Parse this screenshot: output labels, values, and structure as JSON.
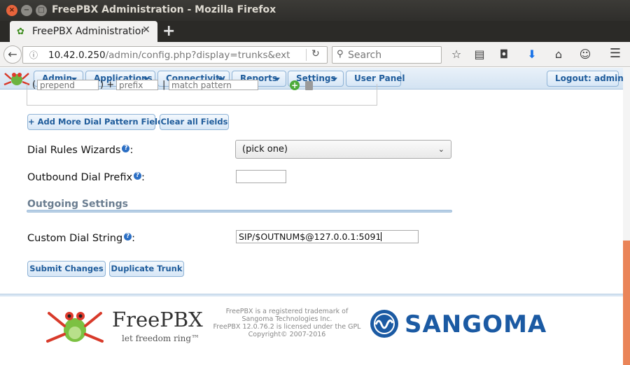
{
  "window": {
    "title": "FreePBX Administration - Mozilla Firefox"
  },
  "browser": {
    "tab_title": "FreePBX Administration",
    "url_host": "10.42.0.250",
    "url_path": "/admin/config.php?display=trunks&ext",
    "search_placeholder": "Search"
  },
  "menu": {
    "items": [
      {
        "label": "Admin"
      },
      {
        "label": "Applications"
      },
      {
        "label": "Connectivity"
      },
      {
        "label": "Reports"
      },
      {
        "label": "Settings"
      },
      {
        "label": "User Panel"
      }
    ],
    "logout": "Logout: admin"
  },
  "dial_pattern": {
    "open_paren": "(",
    "plus": ") +",
    "pipe": "|",
    "prepend_placeholder": "prepend",
    "prefix_placeholder": "prefix",
    "match_placeholder": "match pattern"
  },
  "buttons": {
    "add_more": "+ Add More Dial Pattern Fields",
    "clear_all": "Clear all Fields",
    "submit": "Submit Changes",
    "duplicate": "Duplicate Trunk"
  },
  "fields": {
    "dial_rules_label": "Dial Rules Wizards",
    "dial_rules_value": "(pick one)",
    "outbound_prefix_label": "Outbound Dial Prefix",
    "outbound_prefix_value": "",
    "section_outgoing": "Outgoing Settings",
    "custom_dial_label": "Custom Dial String",
    "custom_dial_value": "SIP/$OUTNUM$@127.0.0.1:5091",
    "colon": ":"
  },
  "footer": {
    "freepbx_name": "FreePBX",
    "freepbx_tagline": "let freedom ring™",
    "legal_line1": "FreePBX is a registered trademark of",
    "legal_line2": "Sangoma Technologies Inc.",
    "legal_line3": "FreePBX 12.0.76.2 is licensed under the GPL",
    "legal_line4": "Copyright© 2007-2016",
    "sangoma_name": "SANGOMA"
  },
  "colors": {
    "accent": "#1f5c9b",
    "scroll_thumb": "#ea8458",
    "sangoma_blue": "#1b5aa3"
  }
}
